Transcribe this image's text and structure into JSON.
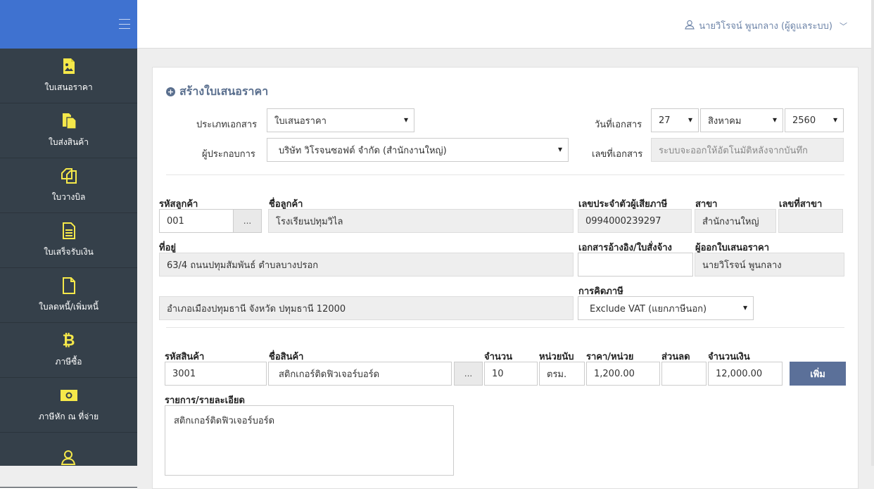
{
  "sidebar": {
    "items": [
      {
        "label": "ใบเสนอราคา",
        "icon": "image-document-icon"
      },
      {
        "label": "ใบส่งสินค้า",
        "icon": "documents-icon"
      },
      {
        "label": "ใบวางบิล",
        "icon": "copy-icon"
      },
      {
        "label": "ใบเสร็จรับเงิน",
        "icon": "document-lines-icon"
      },
      {
        "label": "ใบลดหนี้/เพิ่มหนี้",
        "icon": "blank-document-icon"
      },
      {
        "label": "ภาษีซื้อ",
        "icon": "bitcoin-icon"
      },
      {
        "label": "ภาษีหัก ณ ที่จ่าย",
        "icon": "money-icon"
      },
      {
        "label": "",
        "icon": "users-icon"
      }
    ]
  },
  "header": {
    "user_label": "นายวิโรจน์ พูนกลาง (ผู้ดูแลระบบ)"
  },
  "form": {
    "title": "สร้างใบเสนอราคา",
    "doc_type_label": "ประเภทเอกสาร",
    "doc_type_value": "ใบเสนอราคา",
    "operator_label": "ผู้ประกอบการ",
    "operator_value": "บริษัท วิโรจนซอฟต์ จำกัด (สำนักงานใหญ่)",
    "doc_date_label": "วันที่เอกสาร",
    "doc_day": "27",
    "doc_month": "สิงหาคม",
    "doc_year": "2560",
    "doc_no_label": "เลขที่เอกสาร",
    "doc_no_placeholder": "ระบบจะออกให้อัตโนมัติหลังจากบันทึก",
    "customer_code_label": "รหัสลูกค้า",
    "customer_code": "001",
    "dots": "...",
    "customer_name_label": "ชื่อลูกค้า",
    "customer_name": "โรงเรียนปทุมวิไล",
    "tax_id_label": "เลขประจำตัวผู้เสียภาษี",
    "tax_id": "0994000239297",
    "branch_label": "สาขา",
    "branch": "สำนักงานใหญ่",
    "branch_no_label": "เลขที่สาขา",
    "branch_no": "",
    "address_label": "ที่อยู่",
    "address_line1": "63/4 ถนนปทุมสัมพันธ์ ตำบลบางปรอก",
    "address_line2": "อำเภอเมืองปทุมธานี จังหวัด ปทุมธานี 12000",
    "ref_doc_label": "เอกสารอ้างอิง/ใบสั่งจ้าง",
    "ref_doc": "",
    "issuer_label": "ผู้ออกใบเสนอราคา",
    "issuer": "นายวิโรจน์ พูนกลาง",
    "tax_calc_label": "การคิดภาษี",
    "tax_calc": "Exclude VAT (แยกภาษีนอก)"
  },
  "item": {
    "code_label": "รหัสสินค้า",
    "code": "3001",
    "name_label": "ชื่อสินค้า",
    "name": "สติกเกอร์ติดฟิวเจอร์บอร์ด",
    "qty_label": "จำนวน",
    "qty": "10",
    "unit_label": "หน่วยนับ",
    "unit": "ตรม.",
    "price_label": "ราคา/หน่วย",
    "price": "1,200.00",
    "discount_label": "ส่วนลด",
    "discount": "",
    "amount_label": "จำนวนเงิน",
    "amount": "12,000.00",
    "add_button": "เพิ่ม",
    "detail_label": "รายการ/รายละเอียด",
    "detail": "สติกเกอร์ติดฟิวเจอร์บอร์ด"
  },
  "colors": {
    "sidebar_bg": "#35404a",
    "brand_bg": "#3f72d0",
    "icon_yellow": "#f5e84a",
    "accent": "#5b7099"
  }
}
